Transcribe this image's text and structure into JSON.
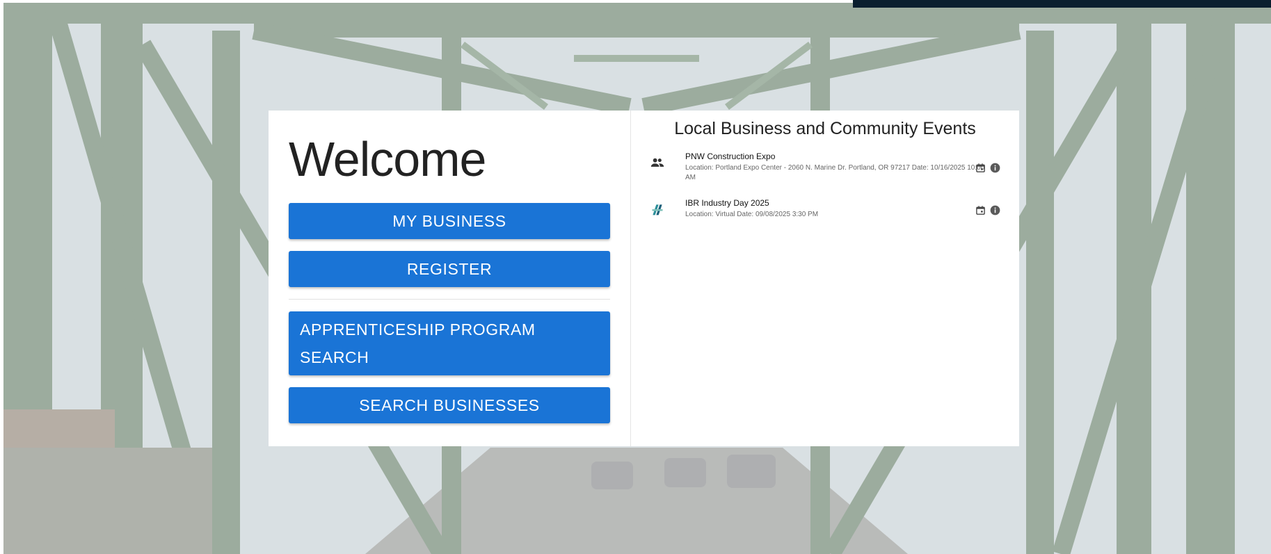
{
  "welcome": {
    "heading": "Welcome"
  },
  "buttons": {
    "my_business": "MY BUSINESS",
    "register": "REGISTER",
    "apprenticeship_line1": "APPRENTICESHIP PROGRAM",
    "apprenticeship_line2": "SEARCH",
    "search_businesses": "SEARCH BUSINESSES"
  },
  "events": {
    "title": "Local Business and Community Events",
    "items": [
      {
        "name": "PNW Construction Expo",
        "details": "Location: Portland Expo Center - 2060 N. Marine Dr. Portland, OR 97217 Date: 10/16/2025 10:00 AM",
        "icon": "group-icon"
      },
      {
        "name": "IBR Industry Day 2025",
        "details": "Location: Virtual Date: 09/08/2025 3:30 PM",
        "icon": "ibr-logo-icon"
      }
    ]
  },
  "colors": {
    "primary_button": "#1a74d6",
    "top_bar": "#0a1f2f"
  }
}
